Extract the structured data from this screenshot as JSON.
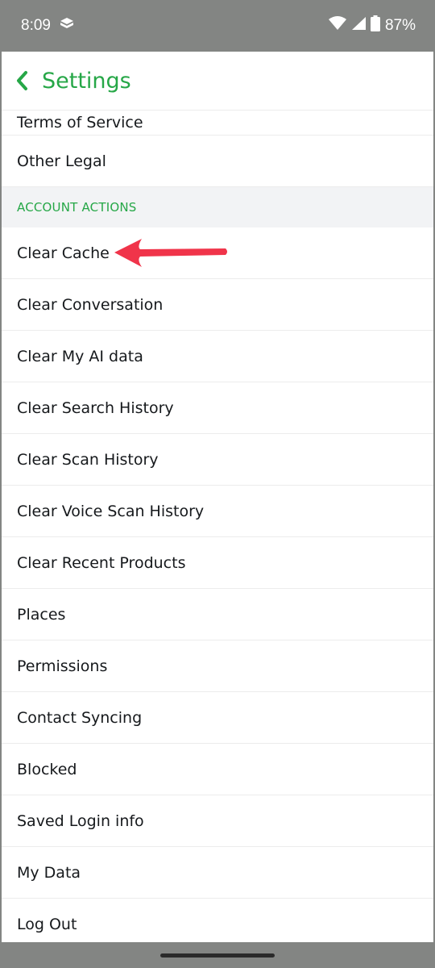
{
  "status_bar": {
    "time": "8:09",
    "battery": "87%",
    "icons": [
      "notification-icon",
      "wifi-icon",
      "signal-icon",
      "battery-icon"
    ]
  },
  "header": {
    "title": "Settings",
    "back_icon": "chevron-left-icon",
    "accent_color": "#26a747"
  },
  "list": {
    "partial_item": "Terms of Service",
    "top_item": "Other Legal",
    "section_title": "ACCOUNT ACTIONS",
    "items": [
      "Clear Cache",
      "Clear Conversation",
      "Clear My AI data",
      "Clear Search History",
      "Clear Scan History",
      "Clear Voice Scan History",
      "Clear Recent Products",
      "Places",
      "Permissions",
      "Contact Syncing",
      "Blocked",
      "Saved Login info",
      "My Data",
      "Log Out"
    ]
  },
  "annotation": {
    "icon": "red-arrow-icon",
    "color": "#f0344a",
    "points_to": "Clear Cache"
  }
}
